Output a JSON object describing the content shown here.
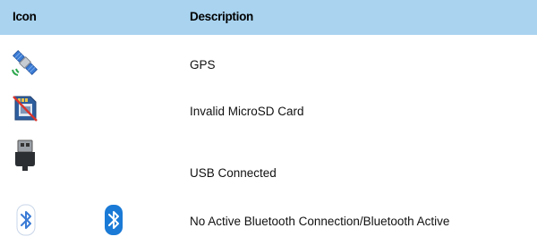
{
  "table": {
    "header": {
      "icon": "Icon",
      "description": "Description"
    },
    "rows": [
      {
        "icons": [
          "satellite-icon"
        ],
        "description": "GPS"
      },
      {
        "icons": [
          "invalid-sd-card-icon"
        ],
        "description": "Invalid MicroSD Card"
      },
      {
        "icons": [
          "usb-plug-icon"
        ],
        "description": "USB Connected"
      },
      {
        "icons": [
          "bluetooth-inactive-icon",
          "bluetooth-active-icon"
        ],
        "description": "No Active Bluetooth Connection/Bluetooth Active"
      }
    ]
  },
  "colors": {
    "header_bg": "#a9d3ef",
    "bluetooth_active": "#1a7ad6",
    "bluetooth_inactive": "#3a7bd5"
  }
}
